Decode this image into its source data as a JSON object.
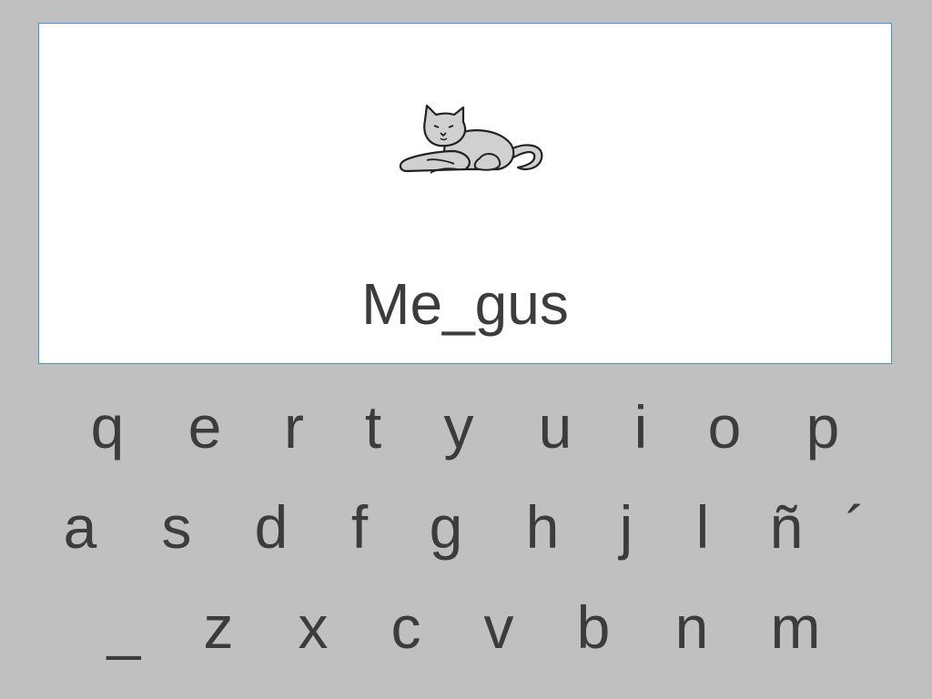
{
  "exercise": {
    "image_icon": "cat-icon",
    "word": "Me_gus"
  },
  "keyboard": {
    "row1": [
      "q",
      "e",
      "r",
      "t",
      "y",
      "u",
      "i",
      "o",
      "p"
    ],
    "row2": [
      "a",
      "s",
      "d",
      "f",
      "g",
      "h",
      "j",
      "l",
      "ñ",
      "´"
    ],
    "row3": [
      "_",
      "z",
      "x",
      "c",
      "v",
      "b",
      "n",
      "m"
    ]
  },
  "colors": {
    "background": "#c0c0c0",
    "card": "#ffffff",
    "card_border": "#3a9ad9",
    "text": "#3c3c3c"
  }
}
